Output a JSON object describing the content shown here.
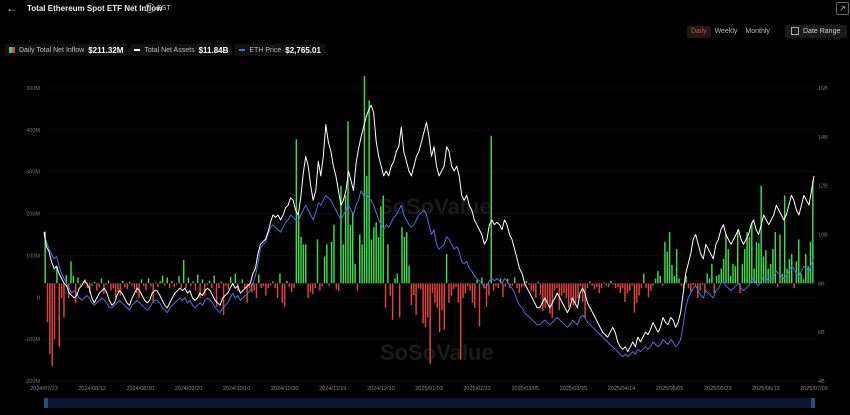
{
  "header": {
    "title": "Total Ethereum Spot ETF Net Inflow",
    "timezone": "EST"
  },
  "tabs": [
    {
      "label": "Daily",
      "active": true
    },
    {
      "label": "Weekly",
      "active": false
    },
    {
      "label": "Monthly",
      "active": false
    }
  ],
  "date_range_label": "Date Range",
  "legend": [
    {
      "label": "Daily Total Net Inflow",
      "value": "$211.32M",
      "color": "#3ddc4a"
    },
    {
      "label": "Total Net Assets",
      "value": "$11.84B",
      "color": "#ffffff"
    },
    {
      "label": "ETH Price",
      "value": "$2,765.01",
      "color": "#4f6fe0"
    }
  ],
  "watermark": "SoSoValue",
  "chart_data": {
    "type": "bar",
    "title": "Total Ethereum Spot ETF Net Inflow",
    "y_left": {
      "ticks": [
        "300M",
        "400M",
        "300M",
        "200M",
        "100M",
        "0",
        "-100M",
        "-200M"
      ],
      "range": [
        -200,
        400
      ],
      "unit": "M"
    },
    "y_right": {
      "ticks": [
        "16B",
        "14B",
        "12B",
        "10B",
        "8B",
        "6B",
        "4B"
      ],
      "range": [
        4,
        16
      ],
      "unit": "B"
    },
    "x_ticks": [
      "2024/07/23",
      "2024/08/12",
      "2024/08/30",
      "2024/09/20",
      "2024/10/10",
      "2024/10/30",
      "2024/11/19",
      "2024/12/10",
      "2025/01/03",
      "2025/02/12",
      "2025/03/05",
      "2025/03/25",
      "2025/04/14",
      "2025/05/05",
      "2025/05/23",
      "2025/06/13",
      "2025/07/09"
    ],
    "colors": {
      "positive": "#3ddc4a",
      "negative": "#e0453b",
      "assets": "#ffffff",
      "price": "#4f6fe0"
    },
    "inflow_M": [
      106,
      -80,
      -145,
      -170,
      -114,
      35,
      -130,
      -30,
      -70,
      17,
      -30,
      45,
      15,
      -40,
      12,
      -5,
      -2,
      8,
      -10,
      -20,
      -5,
      3,
      -15,
      -8,
      10,
      -22,
      -3,
      6,
      -15,
      -10,
      -30,
      -18,
      -25,
      5,
      -8,
      -12,
      3,
      -5,
      -12,
      -20,
      -30,
      8,
      -6,
      -15,
      10,
      -6,
      -40,
      2,
      -8,
      4,
      16,
      -5,
      12,
      -10,
      5,
      -8,
      -3,
      15,
      -10,
      48,
      -10,
      12,
      -6,
      4,
      -15,
      18,
      -30,
      8,
      -25,
      -4,
      5,
      -10,
      16,
      -48,
      -10,
      3,
      -65,
      -5,
      -12,
      13,
      -5,
      20,
      -16,
      1,
      8,
      -10,
      -40,
      -10,
      -18,
      -15,
      -30,
      18,
      -10,
      -6,
      -25,
      -10,
      -5,
      4,
      -10,
      -30,
      20,
      -40,
      -48,
      5,
      -8,
      -18,
      -10,
      295,
      140,
      95,
      80,
      80,
      -30,
      -18,
      -22,
      -10,
      90,
      -15,
      -6,
      55,
      80,
      -5,
      85,
      120,
      -12,
      -15,
      200,
      80,
      180,
      332,
      120,
      145,
      40,
      -15,
      100,
      80,
      425,
      220,
      375,
      90,
      115,
      125,
      95,
      158,
      180,
      -50,
      80,
      -25,
      -75,
      10,
      20,
      -70,
      115,
      95,
      105,
      36,
      -45,
      -24,
      -65,
      -10,
      -12,
      -82,
      -90,
      -70,
      -165,
      -20,
      -40,
      -50,
      -100,
      -55,
      -95,
      60,
      -40,
      -25,
      -12,
      -8,
      -40,
      -156,
      -30,
      -20,
      -6,
      -15,
      -40,
      -50,
      7,
      -88,
      12,
      -7,
      -48,
      -25,
      302,
      -15,
      -5,
      -10,
      10,
      -28,
      -7,
      10,
      -10,
      -5,
      12,
      -10,
      -20,
      -8,
      -6,
      5,
      -3,
      -15,
      -16,
      -30,
      3,
      -24,
      -56,
      -50,
      -40,
      -62,
      -70,
      -15,
      -10,
      -55,
      -25,
      -20,
      -30,
      -50,
      -35,
      -45,
      -40,
      -30,
      -6,
      -38,
      -70,
      -10,
      4,
      -5,
      -12,
      -8,
      -20,
      -10,
      2,
      -5,
      -8,
      5,
      -3,
      -10,
      -8,
      -20,
      -10,
      -38,
      -20,
      -15,
      -5,
      -60,
      -40,
      -25,
      -10,
      20,
      -10,
      -28,
      -15,
      -5,
      10,
      25,
      15,
      -5,
      85,
      65,
      105,
      38,
      15,
      70,
      10,
      -5,
      -10,
      15,
      -10,
      -18,
      -4,
      -5,
      -30,
      -15,
      -3,
      -20,
      20,
      10,
      40,
      -20,
      15,
      18,
      30,
      50,
      100,
      70,
      15,
      40,
      35,
      110,
      -20,
      40,
      70,
      105,
      95,
      125,
      30,
      85,
      82,
      200,
      55,
      68,
      30,
      40,
      70,
      105,
      -8,
      100,
      20,
      180,
      30,
      50,
      60,
      -10,
      45,
      90,
      20,
      8,
      60,
      35,
      85,
      211
    ],
    "assets_B": [
      10.1,
      9.5,
      9.3,
      8.9,
      8.6,
      8.7,
      8.4,
      8.2,
      8.0,
      7.9,
      7.6,
      7.5,
      7.4,
      7.5,
      7.8,
      7.9,
      8.1,
      8.0,
      7.8,
      7.4,
      7.2,
      7.4,
      7.6,
      7.7,
      7.8,
      7.6,
      7.3,
      7.1,
      7.2,
      7.5,
      7.7,
      7.6,
      7.4,
      7.2,
      7.1,
      7.4,
      7.6,
      7.8,
      7.7,
      7.5,
      7.3,
      7.2,
      7.3,
      7.6,
      7.7,
      7.7,
      7.5,
      7.3,
      7.1,
      7.0,
      7.2,
      7.4,
      7.6,
      7.7,
      7.8,
      7.7,
      7.8,
      7.6,
      7.7,
      7.4,
      7.3,
      7.4,
      7.6,
      7.5,
      7.7,
      7.8,
      7.7,
      7.5,
      7.3,
      7.2,
      7.1,
      7.4,
      7.5,
      7.6,
      7.8,
      8.0,
      7.8,
      7.9,
      7.6,
      7.7,
      7.8,
      7.9,
      8.0,
      8.4,
      8.6,
      9.2,
      9.6,
      9.7,
      9.8,
      10.1,
      10.5,
      10.8,
      10.7,
      10.8,
      10.6,
      10.8,
      11.1,
      11.2,
      11.5,
      11.4,
      11.0,
      10.8,
      11.5,
      12.5,
      13.2,
      12.8,
      12.0,
      11.4,
      11.8,
      13.0,
      12.4,
      13.2,
      14.5,
      13.8,
      13.4,
      12.8,
      12.4,
      11.8,
      11.2,
      11.4,
      11.8,
      12.6,
      12.2,
      11.8,
      12.9,
      13.5,
      14.0,
      14.4,
      14.8,
      15.1,
      15.3,
      15.0,
      13.8,
      13.2,
      12.8,
      12.4,
      12.6,
      12.4,
      12.8,
      13.0,
      13.4,
      13.6,
      14.4,
      13.4,
      13.0,
      12.6,
      12.4,
      12.8,
      13.2,
      13.4,
      13.8,
      14.2,
      14.6,
      14.0,
      13.2,
      13.6,
      12.8,
      12.4,
      12.6,
      12.8,
      13.6,
      13.4,
      12.8,
      12.6,
      12.8,
      12.4,
      11.6,
      11.4,
      11.6,
      11.2,
      11.0,
      10.6,
      10.4,
      10.2,
      10.0,
      9.6,
      9.8,
      10.4,
      10.6,
      10.4,
      10.5,
      10.4,
      10.2,
      10.6,
      10.4,
      10.0,
      9.8,
      9.4,
      9.0,
      8.6,
      8.4,
      8.0,
      7.8,
      7.6,
      7.4,
      7.2,
      7.0,
      7.0,
      7.2,
      7.4,
      7.2,
      7.0,
      7.2,
      7.4,
      7.6,
      7.4,
      7.2,
      7.0,
      6.8,
      7.0,
      7.4,
      7.2,
      7.0,
      7.6,
      7.8,
      7.6,
      7.2,
      7.0,
      6.8,
      6.6,
      6.4,
      6.2,
      6.0,
      5.9,
      5.8,
      6.0,
      6.2,
      6.0,
      5.6,
      5.4,
      5.3,
      5.4,
      5.2,
      5.4,
      5.6,
      5.4,
      5.8,
      5.6,
      5.8,
      6.0,
      5.9,
      6.1,
      6.4,
      6.2,
      6.0,
      6.2,
      6.6,
      6.4,
      6.3,
      6.6,
      6.5,
      6.2,
      6.4,
      6.8,
      7.6,
      8.4,
      8.8,
      9.2,
      9.8,
      10.0,
      9.6,
      9.2,
      9.0,
      9.6,
      9.4,
      9.2,
      9.0,
      9.6,
      9.8,
      10.2,
      10.4,
      10.0,
      9.8,
      9.6,
      9.8,
      10.0,
      10.2,
      9.8,
      9.6,
      9.8,
      10.0,
      10.4,
      10.6,
      10.2,
      10.0,
      10.4,
      10.8,
      10.6,
      10.4,
      10.6,
      10.8,
      11.2,
      11.0,
      10.8,
      10.6,
      10.8,
      11.2,
      11.6,
      11.4,
      11.0,
      10.8,
      11.2,
      11.6,
      11.4,
      11.2,
      11.8,
      12.4
    ],
    "price_B_scale": [
      10.0,
      9.7,
      9.4,
      9.2,
      9.0,
      9.1,
      8.7,
      8.4,
      8.2,
      8.0,
      7.8,
      7.6,
      7.7,
      7.6,
      7.4,
      7.3,
      7.4,
      7.5,
      7.4,
      7.2,
      7.1,
      7.2,
      7.3,
      7.4,
      7.3,
      7.2,
      7.0,
      7.0,
      7.1,
      7.2,
      7.3,
      7.2,
      7.1,
      7.0,
      6.9,
      7.1,
      7.2,
      7.3,
      7.2,
      7.1,
      7.0,
      6.9,
      7.0,
      7.2,
      7.3,
      7.3,
      7.2,
      7.0,
      6.9,
      6.8,
      7.0,
      7.1,
      7.2,
      7.3,
      7.4,
      7.3,
      7.4,
      7.2,
      7.3,
      7.1,
      7.0,
      7.1,
      7.2,
      7.1,
      7.3,
      7.4,
      7.3,
      7.2,
      7.0,
      6.9,
      6.8,
      7.0,
      7.1,
      7.2,
      7.4,
      7.6,
      7.4,
      7.5,
      7.3,
      7.4,
      7.5,
      7.6,
      7.7,
      8.0,
      8.3,
      8.8,
      9.4,
      9.6,
      9.7,
      10.0,
      10.3,
      10.4,
      10.3,
      10.2,
      10.1,
      10.3,
      10.5,
      10.6,
      10.8,
      10.7,
      10.6,
      10.5,
      10.8,
      11.0,
      11.2,
      11.0,
      10.8,
      10.6,
      10.9,
      11.3,
      11.2,
      11.4,
      11.6,
      11.5,
      11.4,
      11.2,
      11.0,
      10.8,
      10.6,
      10.8,
      11.0,
      11.2,
      11.0,
      10.8,
      11.2,
      11.4,
      11.8,
      11.6,
      11.7,
      11.5,
      11.4,
      11.2,
      10.9,
      10.6,
      10.4,
      10.2,
      10.4,
      10.3,
      10.5,
      10.7,
      10.8,
      11.0,
      11.2,
      10.8,
      10.6,
      10.4,
      10.3,
      10.4,
      10.6,
      10.8,
      10.9,
      11.0,
      10.8,
      10.4,
      10.0,
      10.2,
      9.6,
      9.4,
      9.5,
      9.6,
      9.9,
      9.8,
      9.6,
      9.4,
      9.5,
      9.3,
      8.9,
      8.8,
      8.9,
      8.6,
      8.5,
      8.3,
      8.2,
      8.1,
      8.0,
      7.8,
      7.9,
      8.1,
      8.2,
      8.1,
      8.2,
      8.1,
      8.0,
      8.2,
      8.1,
      7.9,
      7.8,
      7.6,
      7.3,
      7.1,
      7.0,
      6.8,
      6.7,
      6.6,
      6.5,
      6.4,
      6.3,
      6.3,
      6.4,
      6.5,
      6.4,
      6.3,
      6.4,
      6.5,
      6.6,
      6.5,
      6.4,
      6.3,
      6.2,
      6.3,
      6.5,
      6.4,
      6.3,
      6.6,
      6.7,
      6.6,
      6.4,
      6.3,
      6.2,
      6.1,
      6.0,
      5.9,
      5.8,
      5.7,
      5.6,
      5.5,
      5.4,
      5.3,
      5.2,
      5.1,
      5.0,
      5.1,
      5.0,
      5.1,
      5.2,
      5.1,
      5.3,
      5.2,
      5.3,
      5.4,
      5.3,
      5.4,
      5.6,
      5.5,
      5.4,
      5.5,
      5.7,
      5.6,
      5.5,
      5.7,
      5.6,
      5.4,
      5.5,
      5.7,
      6.3,
      7.0,
      7.4,
      7.6,
      7.8,
      7.9,
      7.7,
      7.5,
      7.4,
      7.7,
      7.6,
      7.5,
      7.4,
      7.7,
      7.8,
      8.0,
      8.1,
      7.9,
      7.8,
      7.7,
      7.8,
      7.9,
      8.0,
      7.8,
      7.7,
      7.8,
      7.9,
      8.1,
      8.2,
      8.0,
      7.9,
      8.1,
      8.3,
      8.2,
      8.1,
      8.2,
      8.3,
      8.5,
      8.4,
      8.3,
      8.2,
      8.3,
      8.5,
      8.7,
      8.6,
      8.4,
      8.3,
      8.5,
      8.7,
      8.6,
      8.5,
      8.8,
      9.1
    ]
  }
}
